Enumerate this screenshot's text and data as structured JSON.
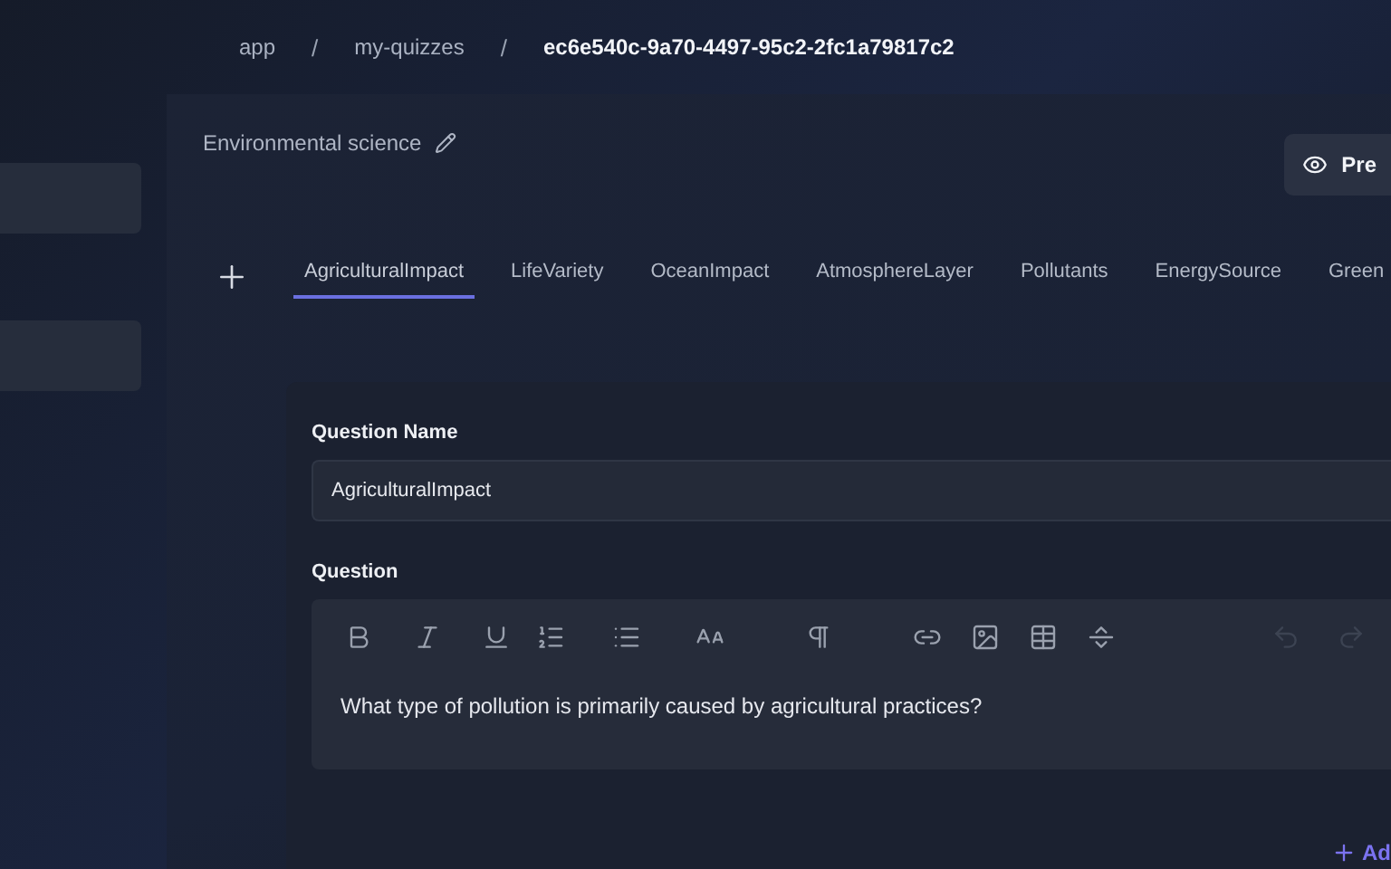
{
  "breadcrumb": [
    {
      "label": "app",
      "current": false
    },
    {
      "label": "my-quizzes",
      "current": false
    },
    {
      "label": "ec6e540c-9a70-4497-95c2-2fc1a79817c2",
      "current": true
    }
  ],
  "breadcrumb_separator": "/",
  "quiz_title": "Environmental science",
  "preview_button": "Pre",
  "tabs": [
    {
      "label": "AgriculturalImpact",
      "selected": true
    },
    {
      "label": "LifeVariety",
      "selected": false
    },
    {
      "label": "OceanImpact",
      "selected": false
    },
    {
      "label": "AtmosphereLayer",
      "selected": false
    },
    {
      "label": "Pollutants",
      "selected": false
    },
    {
      "label": "EnergySource",
      "selected": false
    },
    {
      "label": "Green",
      "selected": false
    }
  ],
  "question_name_label": "Question Name",
  "question_name_value": "AgriculturalImpact",
  "question_label": "Question",
  "toolbar": [
    {
      "kind": "bold",
      "disabled": false
    },
    {
      "kind": "italic",
      "disabled": false
    },
    {
      "kind": "underline",
      "disabled": false
    },
    {
      "kind": "ordered",
      "disabled": false
    },
    {
      "kind": "bullets",
      "disabled": false
    },
    {
      "kind": "size",
      "disabled": false
    },
    {
      "kind": "paragraph",
      "disabled": false
    },
    {
      "kind": "link",
      "disabled": false
    },
    {
      "kind": "image",
      "disabled": false
    },
    {
      "kind": "table",
      "disabled": false
    },
    {
      "kind": "rule",
      "disabled": false
    },
    {
      "kind": "undo",
      "disabled": true
    },
    {
      "kind": "redo",
      "disabled": true
    }
  ],
  "question_text": "What type of pollution is primarily caused by agricultural practices?",
  "add_button": "Ad"
}
